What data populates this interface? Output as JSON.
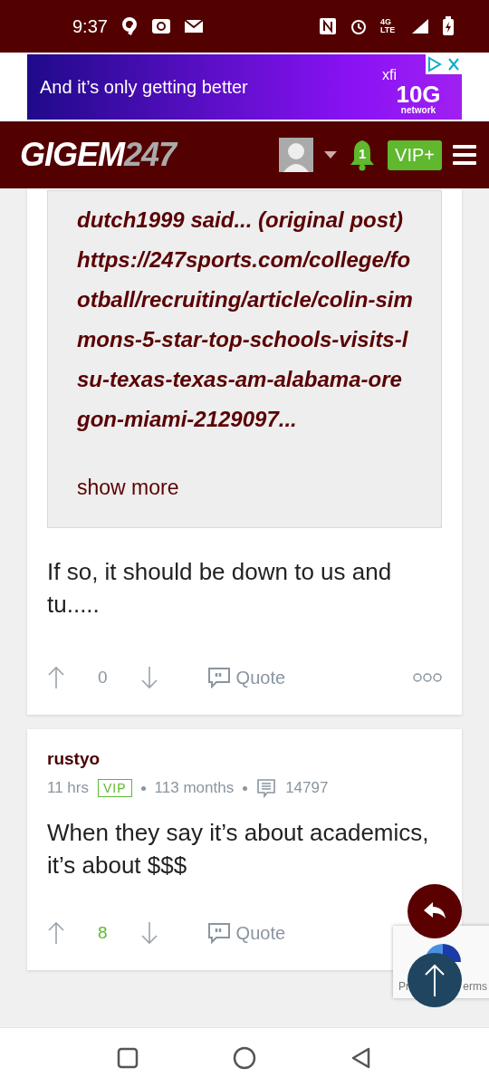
{
  "status_bar": {
    "time": "9:37",
    "network": "4G LTE"
  },
  "ad": {
    "headline": "And it’s only getting better",
    "brand": "xfi",
    "badge": "10G",
    "badge_caption": "network"
  },
  "header": {
    "logo_main": "GIGEM",
    "logo_num": "247",
    "notifications": "1",
    "vip": "VIP+"
  },
  "posts": [
    {
      "quote": {
        "attribution": "dutch1999 said... (original post)",
        "url": "https://247sports.com/college/football/recruiting/article/colin-simmons-5-star-top-schools-visits-lsu-texas-texas-am-alabama-oregon-miami-2129097...",
        "more": "show more"
      },
      "body": "If so, it should be down to us and tu.....",
      "votes": "0",
      "voted": false,
      "quote_label": "Quote",
      "has_menu": true
    },
    {
      "author": "rustyo",
      "time": "11 hrs",
      "tier": "VIP",
      "tenure": "113 months",
      "post_count": "14797",
      "body": "When they say it’s about academics, it’s about $$$",
      "votes": "8",
      "voted": true,
      "quote_label": "Quote",
      "has_menu": false
    }
  ],
  "recaptcha": {
    "left": "Pr",
    "right": "erms"
  }
}
